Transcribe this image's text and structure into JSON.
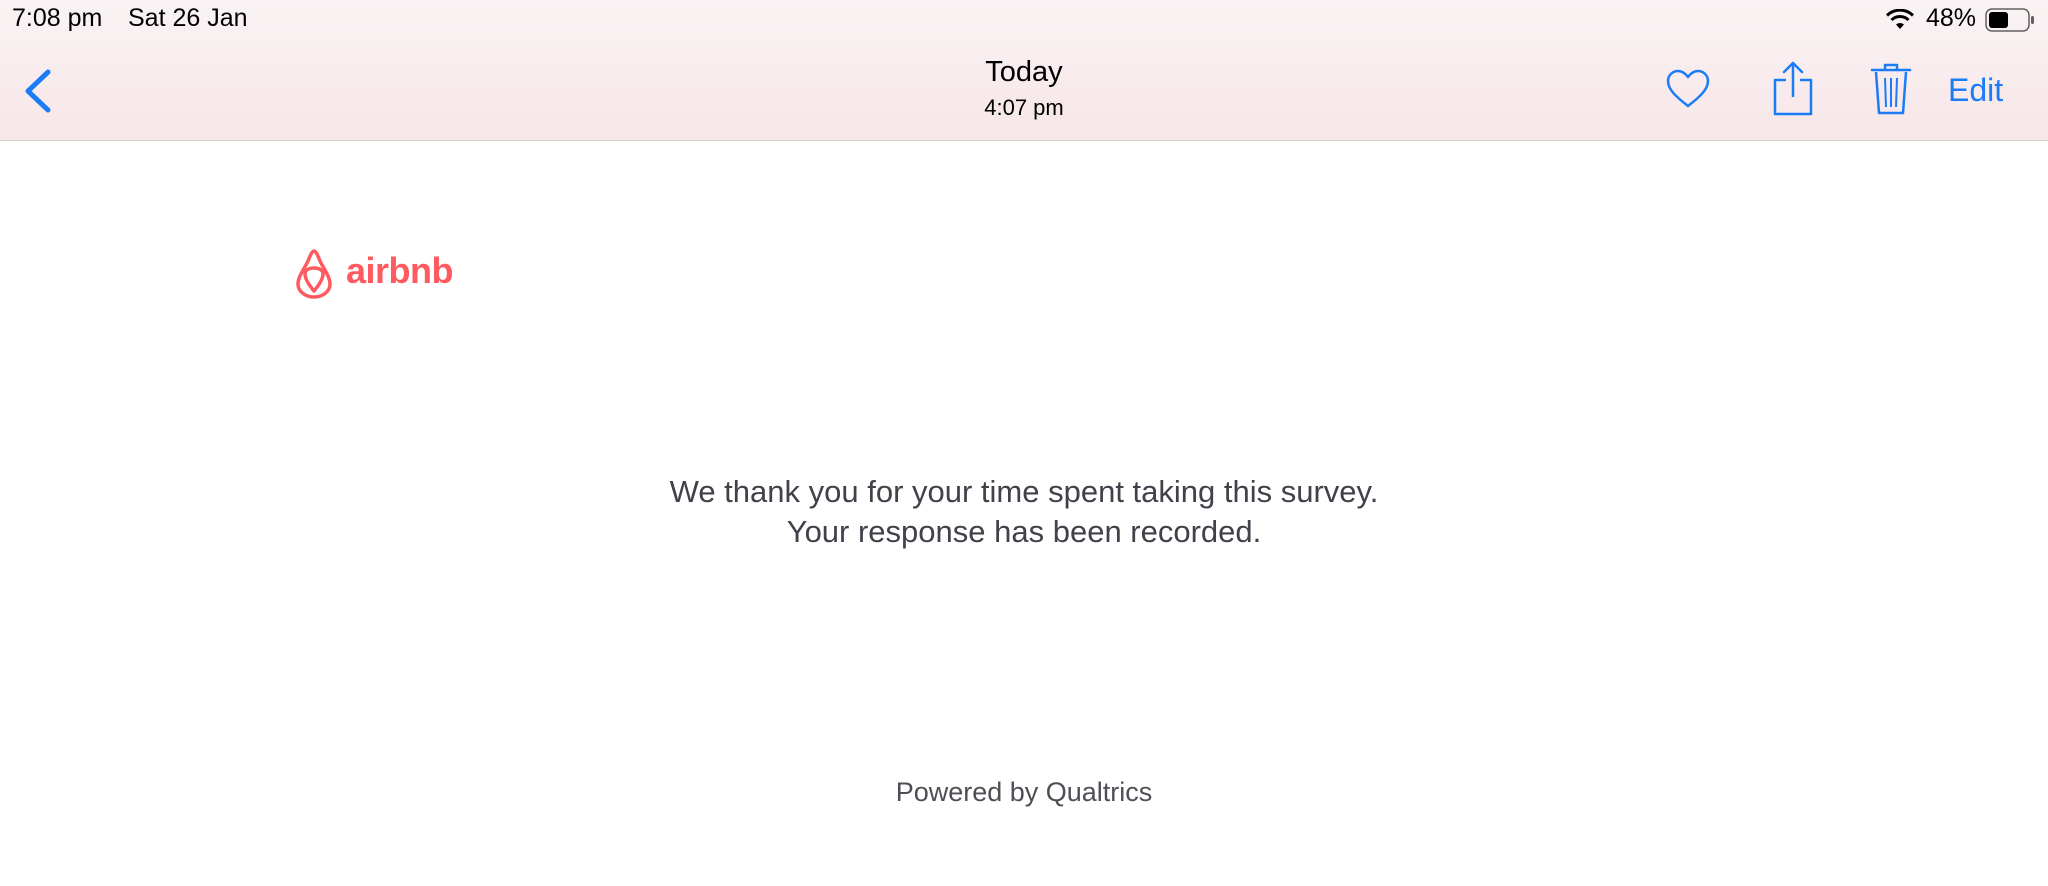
{
  "status_bar": {
    "time": "7:08 pm",
    "date": "Sat 26 Jan",
    "battery_percent": "48%",
    "battery_level": 0.48
  },
  "nav_bar": {
    "title": "Today",
    "subtitle": "4:07 pm",
    "edit_label": "Edit",
    "accent_color": "#1a7cf6"
  },
  "content": {
    "logo_text": "airbnb",
    "logo_color": "#ff5a5f",
    "message_line1": "We thank you for your time spent taking this survey.",
    "message_line2": "Your response has been recorded.",
    "footer": "Powered by Qualtrics"
  }
}
